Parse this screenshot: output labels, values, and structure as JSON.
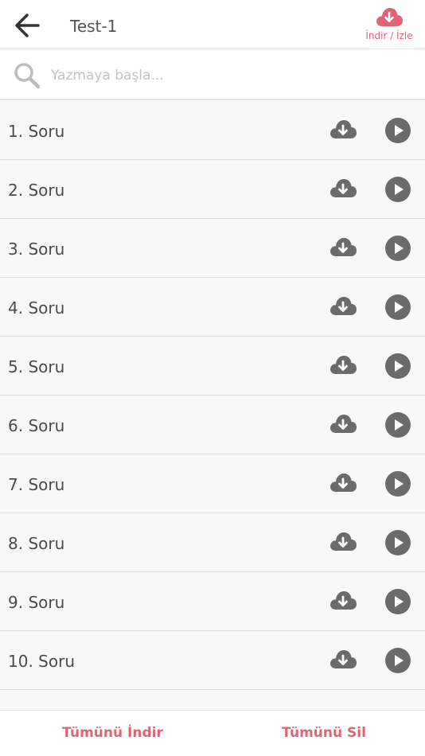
{
  "header": {
    "title": "Test-1",
    "download_label": "İndir / İzle"
  },
  "search": {
    "placeholder": "Yazmaya başla..."
  },
  "items": [
    {
      "label": "1. Soru"
    },
    {
      "label": "2. Soru"
    },
    {
      "label": "3. Soru"
    },
    {
      "label": "4. Soru"
    },
    {
      "label": "5. Soru"
    },
    {
      "label": "6. Soru"
    },
    {
      "label": "7. Soru"
    },
    {
      "label": "8. Soru"
    },
    {
      "label": "9. Soru"
    },
    {
      "label": "10. Soru"
    }
  ],
  "footer": {
    "download_all": "Tümünü İndir",
    "delete_all": "Tümünü Sil"
  },
  "colors": {
    "accent": "#e06478",
    "icon_dark": "#6b6b6b"
  },
  "icons": {
    "back": "arrow-left-icon",
    "header_download": "cloud-download-icon",
    "search": "search-icon",
    "row_download": "cloud-download-icon",
    "row_play": "play-circle-icon"
  }
}
